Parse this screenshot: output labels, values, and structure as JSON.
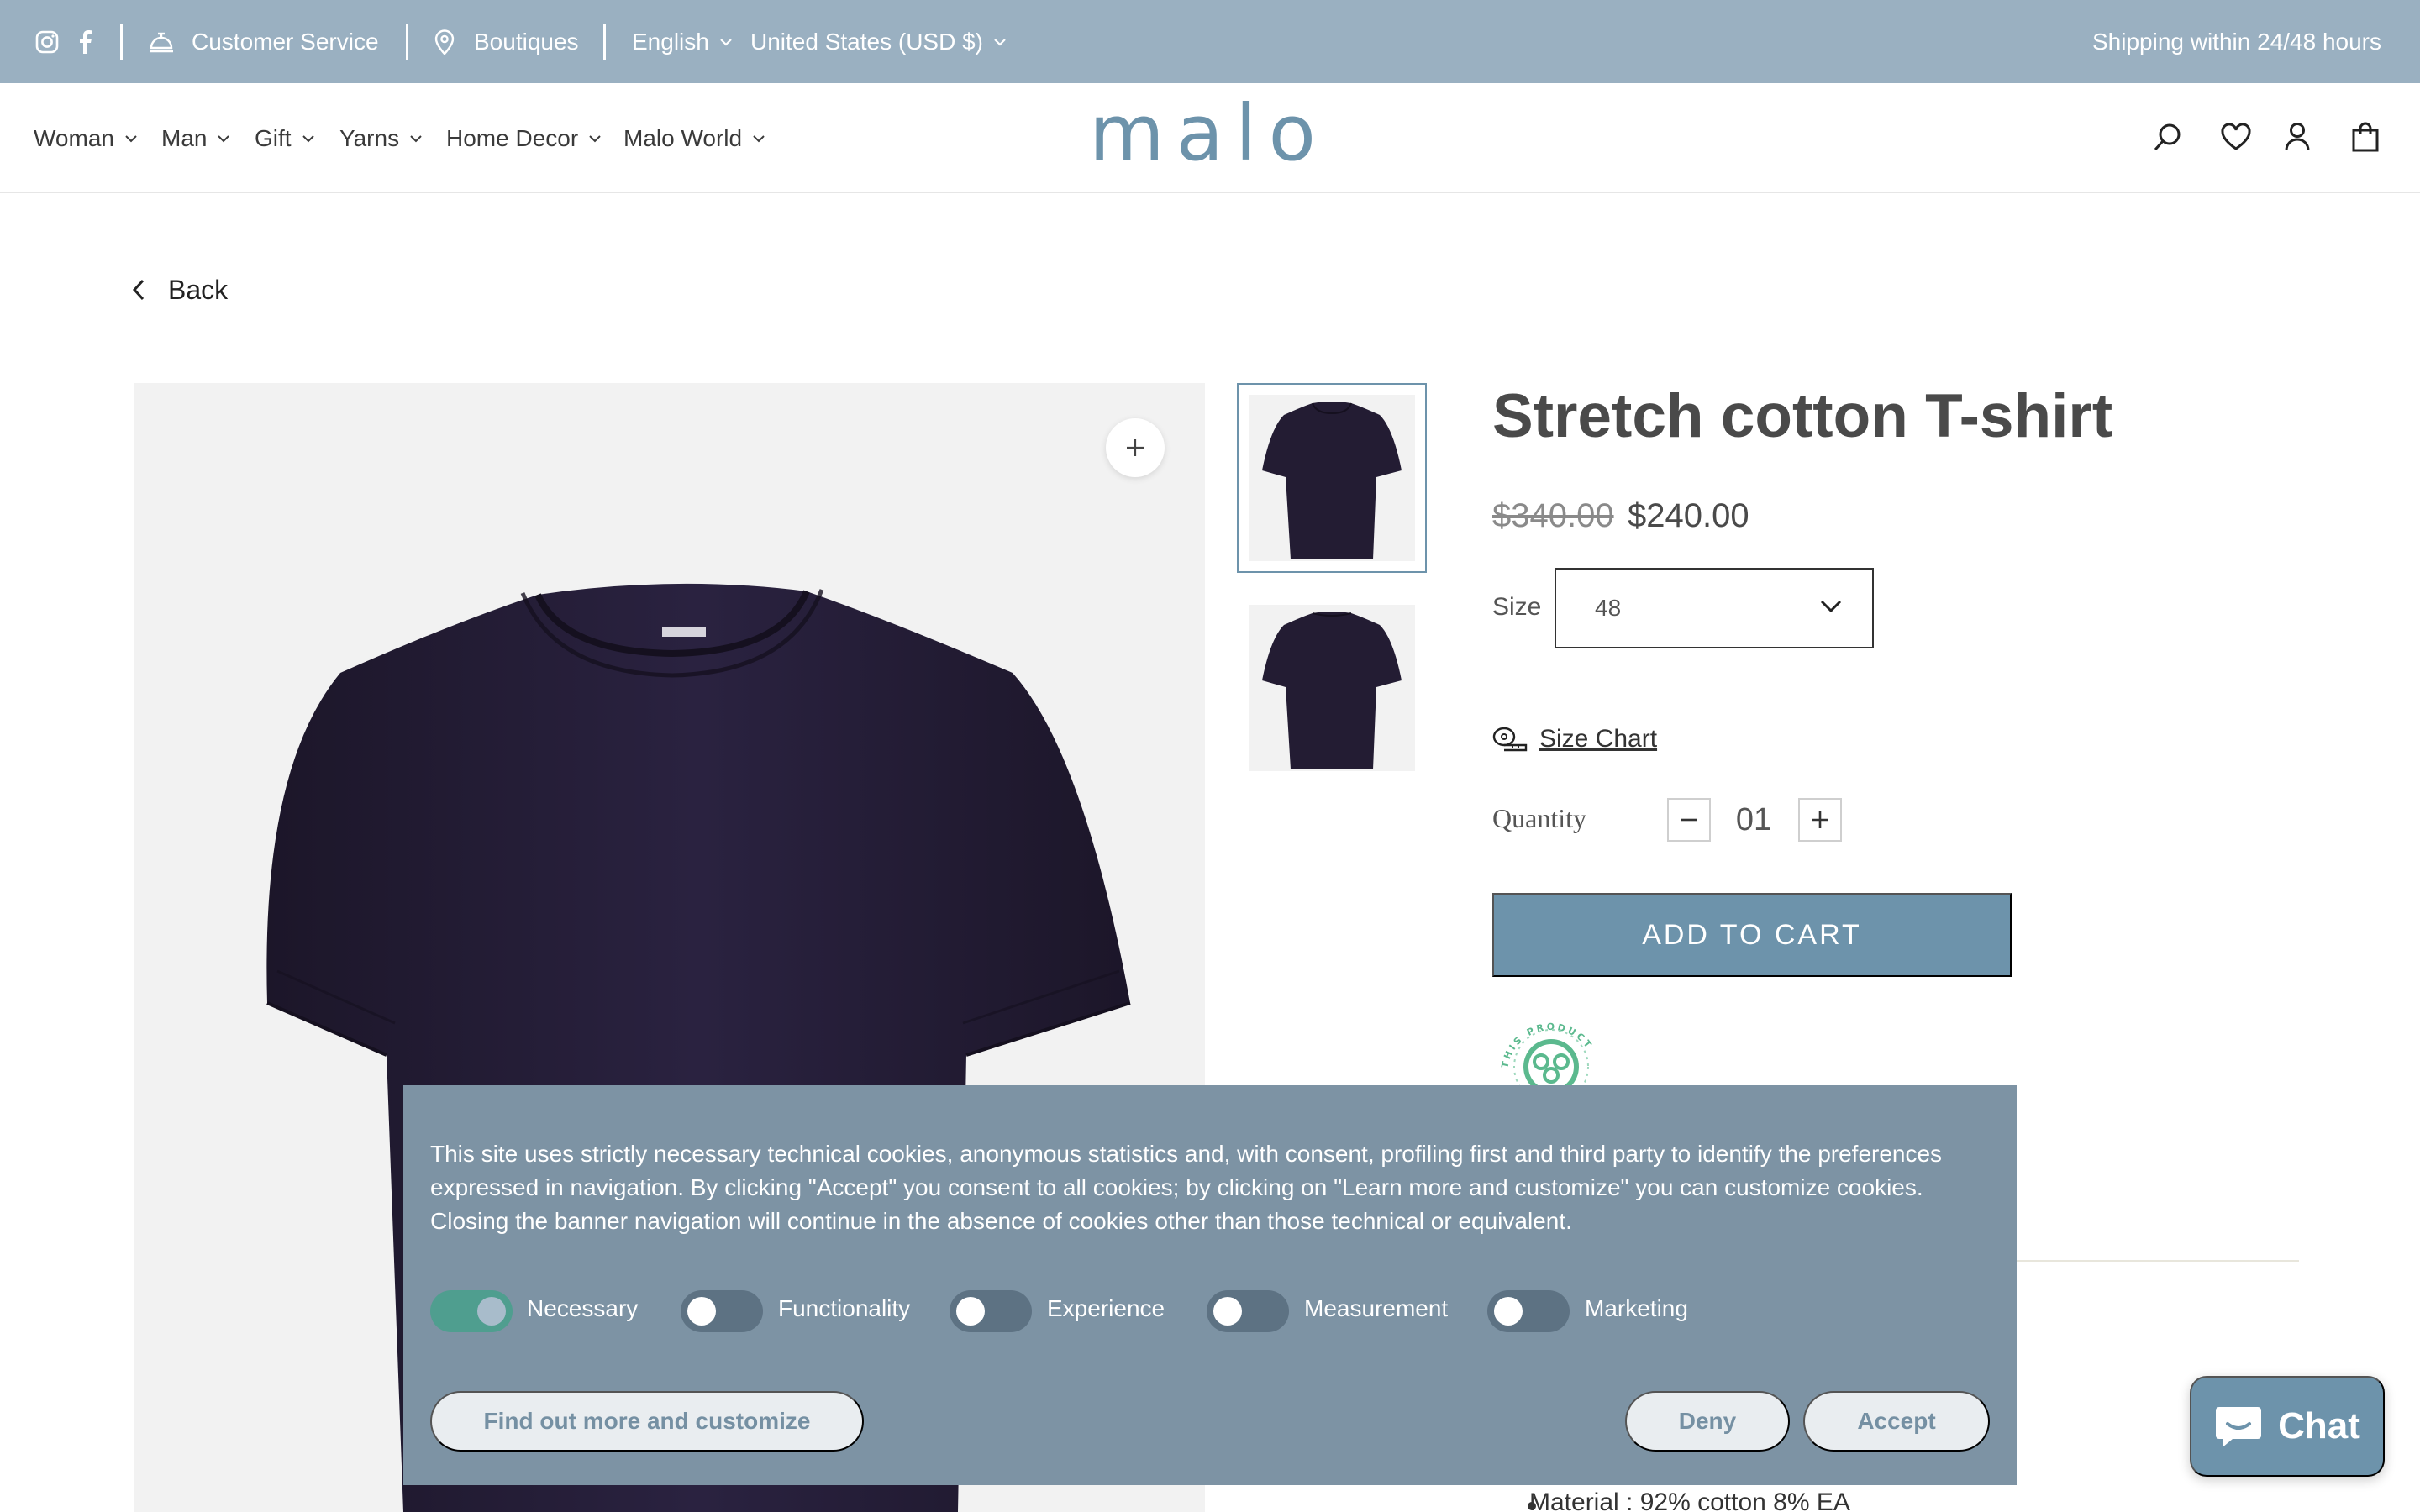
{
  "topbar": {
    "customer_service": "Customer Service",
    "boutiques": "Boutiques",
    "language": "English",
    "currency": "United States (USD $)",
    "shipping": "Shipping within 24/48 hours"
  },
  "nav": {
    "items": [
      "Woman",
      "Man",
      "Gift",
      "Yarns",
      "Home Decor",
      "Malo World"
    ]
  },
  "brand": {
    "logo_text": "malo"
  },
  "back_label": "Back",
  "product": {
    "title": "Stretch cotton T-shirt",
    "price_old": "$340.00",
    "price_new": "$240.00",
    "size_label": "Size",
    "size_value": "48",
    "size_chart": "Size Chart",
    "quantity_label": "Quantity",
    "quantity_value": "01",
    "add_to_cart": "ADD TO CART",
    "badge_text": "THIS PRODUCT",
    "material": "Material : 92% cotton 8% EA"
  },
  "cookie": {
    "text": "This site uses strictly necessary technical cookies, anonymous statistics and, with consent, profiling first and third party to identify the preferences expressed in navigation. By clicking \"Accept\" you consent to all cookies; by clicking on \"Learn more and customize\" you can customize cookies. Closing the banner navigation will continue in the absence of cookies other than those technical or equivalent.",
    "toggles": [
      {
        "label": "Necessary",
        "on": true
      },
      {
        "label": "Functionality",
        "on": false
      },
      {
        "label": "Experience",
        "on": false
      },
      {
        "label": "Measurement",
        "on": false
      },
      {
        "label": "Marketing",
        "on": false
      }
    ],
    "customize_label": "Find out more and customize",
    "deny_label": "Deny",
    "accept_label": "Accept"
  },
  "chat_label": "Chat",
  "colors": {
    "topbar_bg": "#9ab0c1",
    "accent": "#6d93ab",
    "cookie_bg": "#7d93a4",
    "toggle_on": "#4f9e8f",
    "shirt": "#231c33"
  },
  "icons": [
    "instagram-icon",
    "facebook-icon",
    "bell-icon",
    "location-pin-icon",
    "chevron-down-icon",
    "search-icon",
    "heart-icon",
    "user-icon",
    "bag-icon",
    "chevron-left-icon",
    "plus-icon",
    "tape-measure-icon",
    "chat-bubble-icon"
  ]
}
